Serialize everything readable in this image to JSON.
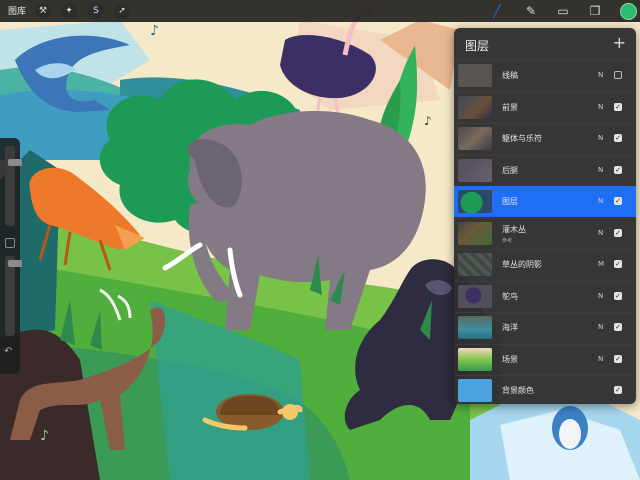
{
  "app": {
    "gallery_label": "图库"
  },
  "toolbar": {
    "left_tools": [
      {
        "name": "wrench-icon",
        "glyph": "⚒"
      },
      {
        "name": "magic-wand-icon",
        "glyph": "✦"
      },
      {
        "name": "selection-icon",
        "glyph": "S"
      },
      {
        "name": "transform-icon",
        "glyph": "➚"
      }
    ],
    "right_tools": [
      {
        "name": "brush-icon",
        "glyph": "╱"
      },
      {
        "name": "smudge-icon",
        "glyph": "✎"
      },
      {
        "name": "eraser-icon",
        "glyph": "▭"
      },
      {
        "name": "layers-icon",
        "glyph": "❐"
      }
    ],
    "active_tool": "brush-icon",
    "accent_color": "#1f6ff5",
    "current_color": "#2dbb6f"
  },
  "layers_panel": {
    "title": "图层",
    "add_glyph": "+",
    "layers": [
      {
        "name": "线稿",
        "sub": "",
        "mode": "N",
        "visible": false,
        "active": false,
        "thumb": "sketch"
      },
      {
        "name": "前景",
        "sub": "",
        "mode": "N",
        "visible": true,
        "active": false,
        "thumb": "foreground"
      },
      {
        "name": "躯体与乐符",
        "sub": "",
        "mode": "N",
        "visible": true,
        "active": false,
        "thumb": "bodies"
      },
      {
        "name": "后腿",
        "sub": "",
        "mode": "N",
        "visible": true,
        "active": false,
        "thumb": "legs"
      },
      {
        "name": "图层",
        "sub": "",
        "mode": "N",
        "visible": true,
        "active": true,
        "thumb": "green-blob"
      },
      {
        "name": "灌木丛",
        "sub": "参考",
        "mode": "N",
        "visible": true,
        "active": false,
        "thumb": "bushes"
      },
      {
        "name": "草丛的阴影",
        "sub": "",
        "mode": "M",
        "visible": true,
        "active": false,
        "thumb": "grass-shadow"
      },
      {
        "name": "鸵鸟",
        "sub": "",
        "mode": "N",
        "visible": true,
        "active": false,
        "thumb": "ostrich"
      },
      {
        "name": "海洋",
        "sub": "",
        "mode": "N",
        "visible": true,
        "active": false,
        "thumb": "ocean"
      },
      {
        "name": "场景",
        "sub": "",
        "mode": "N",
        "visible": true,
        "active": false,
        "thumb": "scene"
      },
      {
        "name": "背景颜色",
        "sub": "",
        "mode": "",
        "visible": true,
        "active": false,
        "thumb": "background"
      }
    ]
  },
  "sidebar": {
    "brush_size_level": 0.82,
    "opacity_level": 0.95,
    "undo_glyph": "↶"
  }
}
